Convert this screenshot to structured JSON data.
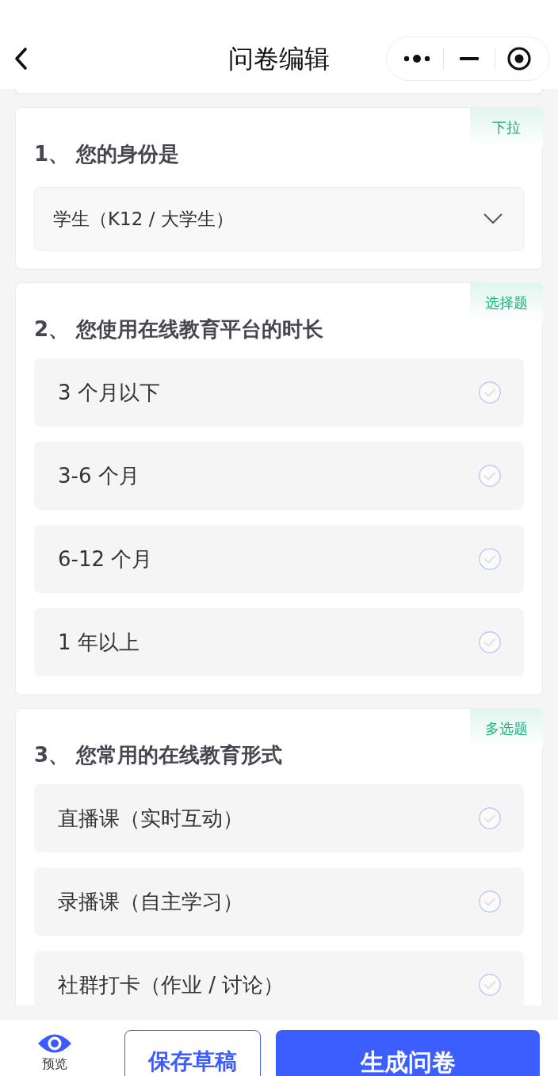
{
  "header": {
    "title": "问卷编辑"
  },
  "questions": [
    {
      "kind": "dropdown",
      "title": "1、 您的身份是",
      "tag": "下拉",
      "value": "学生（K12 / 大学生）"
    },
    {
      "kind": "choice",
      "title": "2、 您使用在线教育平台的时长",
      "tag": "选择题",
      "options": [
        {
          "label": "3 个月以下",
          "selected": false
        },
        {
          "label": "3-6 个月",
          "selected": false
        },
        {
          "label": "6-12 个月",
          "selected": false
        },
        {
          "label": "1 年以上",
          "selected": false
        }
      ]
    },
    {
      "kind": "choice",
      "title": "3、 您常用的在线教育形式",
      "tag": "多选题",
      "options": [
        {
          "label": "直播课（实时互动）",
          "selected": false
        },
        {
          "label": "录播课（自主学习）",
          "selected": false
        },
        {
          "label": "社群打卡（作业 / 讨论）",
          "selected": false
        }
      ]
    }
  ],
  "footer": {
    "preview": "预览",
    "buttons": [
      {
        "kind": "outline",
        "label": "保存草稿"
      },
      {
        "kind": "primary",
        "label": "生成问卷"
      }
    ]
  }
}
